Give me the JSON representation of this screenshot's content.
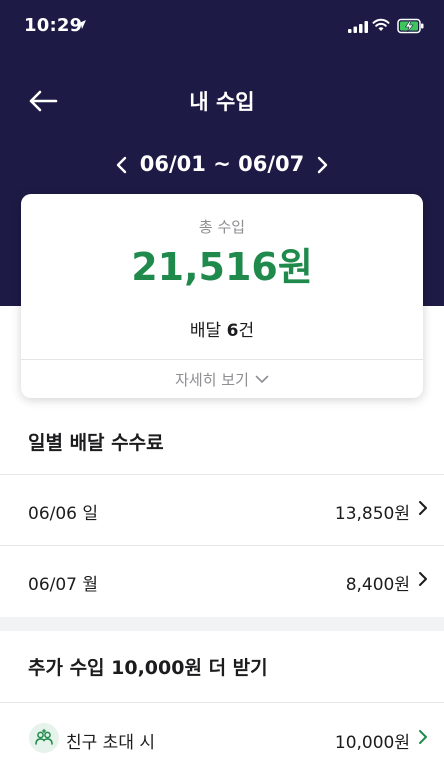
{
  "status_bar": {
    "time": "10:29"
  },
  "header": {
    "title": "내 수입",
    "date_range": "06/01 ~ 06/07"
  },
  "summary": {
    "label": "총 수입",
    "amount": "21,516원",
    "delivery_prefix": "배달 ",
    "delivery_count": "6",
    "delivery_suffix": "건",
    "detail_link": "자세히 보기"
  },
  "daily_fees": {
    "title": "일별 배달 수수료",
    "rows": [
      {
        "date": "06/06 일",
        "amount": "13,850원"
      },
      {
        "date": "06/07 월",
        "amount": "8,400원"
      }
    ]
  },
  "bonus": {
    "title": "추가 수입 10,000원 더 받기",
    "invite_label": "친구 초대 시",
    "invite_amount": "10,000원"
  },
  "colors": {
    "header_bg": "#1d1a45",
    "accent_green": "#1f8a4c"
  }
}
